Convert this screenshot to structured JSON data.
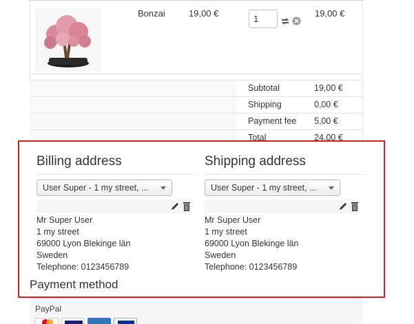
{
  "product": {
    "name": "Bonzai",
    "price": "19,00 €",
    "quantity": "1",
    "row_total": "19,00 €"
  },
  "totals": [
    {
      "label": "Subtotal",
      "value": "19,00 €"
    },
    {
      "label": "Shipping",
      "value": "0,00 €"
    },
    {
      "label": "Payment fee",
      "value": "5,00 €"
    },
    {
      "label": "Total",
      "value": "24,00 €"
    }
  ],
  "billing": {
    "title": "Billing address",
    "selected": "User Super - 1 my street, ...",
    "lines": [
      "Mr Super User",
      "1 my street",
      "69000 Lyon Blekinge län",
      "Sweden",
      "Telephone: 0123456789"
    ]
  },
  "shipping": {
    "title": "Shipping address",
    "selected": "User Super - 1 my street, ...",
    "lines": [
      "Mr Super User",
      "1 my street",
      "69000 Lyon Blekinge län",
      "Sweden",
      "Telephone: 0123456789"
    ]
  },
  "payment": {
    "title": "Payment method",
    "option": "PayPal"
  },
  "colors": {
    "highlight": "#d62020",
    "mastercard": "#eb001b",
    "visa": "#1a1f71",
    "amex": "#2e77bb",
    "paypal": "#003087"
  },
  "icons": [
    "refresh-icon",
    "remove-icon",
    "pencil-icon",
    "trash-icon",
    "caret-down-icon"
  ]
}
